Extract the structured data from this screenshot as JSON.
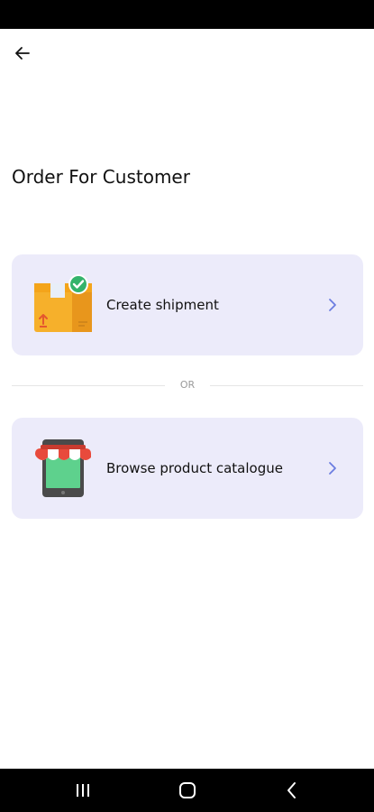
{
  "header": {
    "title": "Order For Customer",
    "back_icon": "arrow-left-icon"
  },
  "options": [
    {
      "label": "Create shipment",
      "icon": "package-check-icon",
      "chevron": "chevron-right-icon"
    },
    {
      "label": "Browse product catalogue",
      "icon": "storefront-tablet-icon",
      "chevron": "chevron-right-icon"
    }
  ],
  "divider": {
    "text": "OR"
  },
  "navigation": {
    "recents_icon": "recents-icon",
    "home_icon": "home-icon",
    "back_icon": "back-chevron-icon"
  },
  "colors": {
    "card_background": "#ecebfa",
    "chevron": "#6b7de0",
    "bars": "#000000"
  }
}
